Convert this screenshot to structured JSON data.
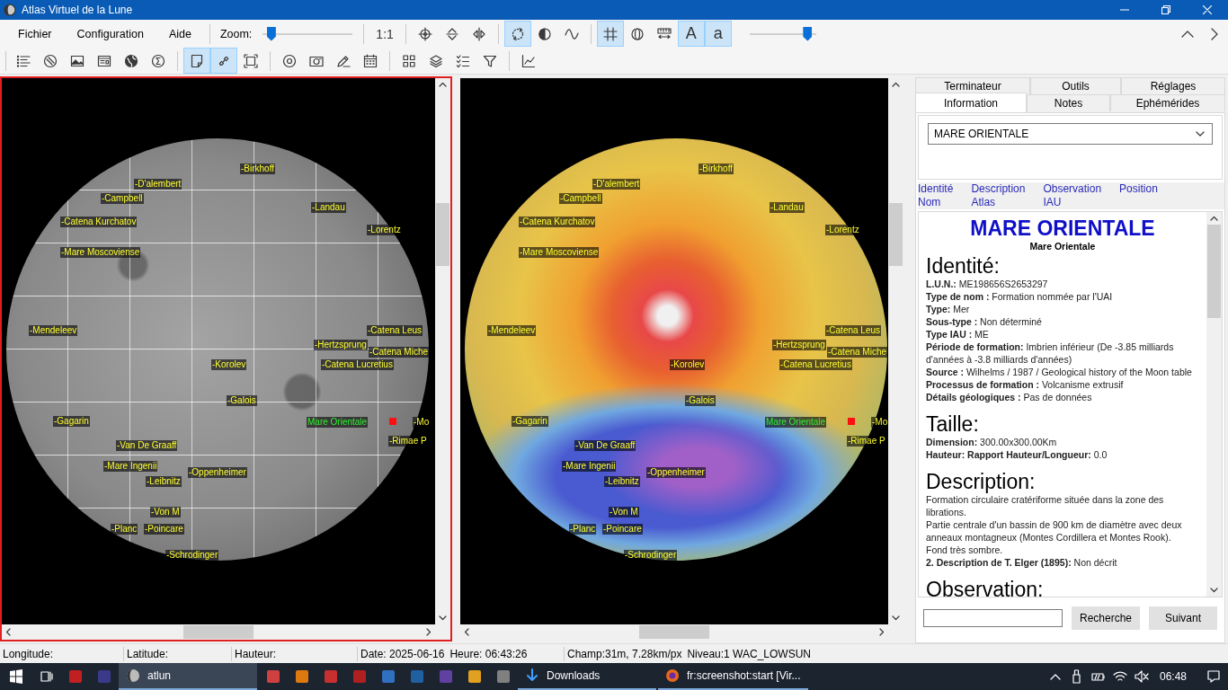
{
  "window": {
    "title": "Atlas Virtuel de la Lune"
  },
  "toolbar": {
    "menus": [
      "Fichier",
      "Configuration",
      "Aide"
    ],
    "zoom_label": "Zoom:",
    "zoom_slider": {
      "level": 0.05
    },
    "tool_groups": [
      [
        {
          "kind": "text",
          "label": "1:1",
          "on": false
        }
      ],
      [
        {
          "kind": "icon",
          "on": false
        },
        {
          "kind": "icon",
          "on": false
        },
        {
          "kind": "icon",
          "on": false
        }
      ],
      [
        {
          "kind": "icon",
          "on": true
        },
        {
          "kind": "icon",
          "on": false
        },
        {
          "kind": "icon",
          "on": false
        }
      ],
      [
        {
          "kind": "icon",
          "on": true
        },
        {
          "kind": "icon",
          "on": false
        },
        {
          "kind": "icon",
          "on": false
        },
        {
          "kind": "text",
          "label": "A",
          "on": true
        },
        {
          "kind": "text",
          "label": "a",
          "on": true
        }
      ]
    ],
    "level_slider": {
      "level": 0.93
    },
    "tool_groups_2": [
      [
        {
          "kind": "icon",
          "on": false
        },
        {
          "kind": "icon",
          "on": false
        },
        {
          "kind": "icon",
          "on": false
        },
        {
          "kind": "icon",
          "on": false
        },
        {
          "kind": "icon",
          "on": false
        },
        {
          "kind": "icon",
          "on": false
        }
      ],
      [
        {
          "kind": "icon",
          "on": true
        },
        {
          "kind": "icon",
          "on": true
        },
        {
          "kind": "icon",
          "on": false
        }
      ],
      [
        {
          "kind": "icon",
          "on": false
        },
        {
          "kind": "icon",
          "on": false
        },
        {
          "kind": "icon",
          "on": false
        },
        {
          "kind": "icon",
          "on": false
        }
      ],
      [
        {
          "kind": "icon",
          "on": false
        },
        {
          "kind": "icon",
          "on": false
        },
        {
          "kind": "icon",
          "on": false
        },
        {
          "kind": "icon",
          "on": false
        }
      ],
      [
        {
          "kind": "icon",
          "on": false
        }
      ]
    ]
  },
  "maps": [
    {
      "kind": "greyscale",
      "active": true,
      "labels": [
        {
          "text": "-Birkhoff",
          "selected": false
        },
        {
          "text": "-D'alembert",
          "selected": false
        },
        {
          "text": "-Campbell",
          "selected": false
        },
        {
          "text": "-Catena Kurchatov",
          "selected": false
        },
        {
          "text": "-Landau",
          "selected": false
        },
        {
          "text": "-Lorentz",
          "selected": false
        },
        {
          "text": "-Mare Moscoviense",
          "selected": false
        },
        {
          "text": "-Mendeleev",
          "selected": false
        },
        {
          "text": "-Catena Leus",
          "selected": false
        },
        {
          "text": "-Hertzsprung",
          "selected": false
        },
        {
          "text": "-Catena Miche",
          "selected": false
        },
        {
          "text": "-Korolev",
          "selected": false
        },
        {
          "text": "-Catena Lucretius",
          "selected": false
        },
        {
          "text": "-Galois",
          "selected": false
        },
        {
          "text": "Mare Orientale",
          "selected": true
        },
        {
          "text": "-Mo",
          "selected": false
        },
        {
          "text": "-Rimae P",
          "selected": false
        },
        {
          "text": "-Gagarin",
          "selected": false
        },
        {
          "text": "-Van De Graaff",
          "selected": false
        },
        {
          "text": "-Mare Ingenii",
          "selected": false
        },
        {
          "text": "-Oppenheimer",
          "selected": false
        },
        {
          "text": "-Leibnitz",
          "selected": false
        },
        {
          "text": "-Von M",
          "selected": false
        },
        {
          "text": "-Planc",
          "selected": false
        },
        {
          "text": "-Poincare",
          "selected": false
        },
        {
          "text": "-Schrodinger",
          "selected": false
        }
      ]
    },
    {
      "kind": "colored",
      "active": false,
      "labels": [
        {
          "text": "-Birkhoff",
          "selected": false
        },
        {
          "text": "-D'alembert",
          "selected": false
        },
        {
          "text": "-Campbell",
          "selected": false
        },
        {
          "text": "-Catena Kurchatov",
          "selected": false
        },
        {
          "text": "-Landau",
          "selected": false
        },
        {
          "text": "-Lorentz",
          "selected": false
        },
        {
          "text": "-Mare Moscoviense",
          "selected": false
        },
        {
          "text": "-Mendeleev",
          "selected": false
        },
        {
          "text": "-Catena Leus",
          "selected": false
        },
        {
          "text": "-Hertzsprung",
          "selected": false
        },
        {
          "text": "-Catena Miche",
          "selected": false
        },
        {
          "text": "-Korolev",
          "selected": false
        },
        {
          "text": "-Catena Lucretius",
          "selected": false
        },
        {
          "text": "-Galois",
          "selected": false
        },
        {
          "text": "Mare Orientale",
          "selected": true
        },
        {
          "text": "-Mo",
          "selected": false
        },
        {
          "text": "-Rimae P",
          "selected": false
        },
        {
          "text": "-Gagarin",
          "selected": false
        },
        {
          "text": "-Van De Graaff",
          "selected": false
        },
        {
          "text": "-Mare Ingenii",
          "selected": false
        },
        {
          "text": "-Oppenheimer",
          "selected": false
        },
        {
          "text": "-Leibnitz",
          "selected": false
        },
        {
          "text": "-Von M",
          "selected": false
        },
        {
          "text": "-Planc",
          "selected": false
        },
        {
          "text": "-Poincare",
          "selected": false
        },
        {
          "text": "-Schrodinger",
          "selected": false
        }
      ]
    }
  ],
  "info_panel": {
    "tab_rows": [
      [
        {
          "label": "Terminateur",
          "selected": false
        },
        {
          "label": "Outils",
          "selected": false
        },
        {
          "label": "Réglages",
          "selected": false
        }
      ],
      [
        {
          "label": "Information",
          "selected": true
        },
        {
          "label": "Notes",
          "selected": false
        },
        {
          "label": "Ephémérides",
          "selected": false
        }
      ]
    ],
    "selector": {
      "value": "MARE ORIENTALE"
    },
    "links": [
      "Identité Nom",
      "Description Atlas",
      "Observation IAU",
      "Position"
    ],
    "title": "MARE ORIENTALE",
    "subtitle": "Mare Orientale",
    "sections": [
      {
        "heading": "Identité:",
        "lines": [
          "**L.U.N.:** ME198656S2653297",
          "**Type de nom :** Formation nommée par l'UAI",
          "**Type:** Mer",
          "**Sous-type :** Non déterminé",
          "**Type IAU :** ME",
          "**Période de formation:** Imbrien inférieur (De -3.85 milliards d'années à -3.8 milliards d'années)",
          "**Source :** Wilhelms / 1987 / Geological history of the Moon table",
          "**Processus de formation :** Volcanisme extrusif",
          "**Détails géologiques :** Pas de données"
        ]
      },
      {
        "heading": "Taille:",
        "lines": [
          "**Dimension:** 300.00x300.00Km",
          "**Hauteur: Rapport Hauteur/Longueur:** 0.0"
        ]
      },
      {
        "heading": "Description:",
        "lines": [
          "Formation circulaire cratériforme située dans la zone des librations.",
          "Partie centrale d'un bassin de 900 km de diamètre avec deux anneaux montagneux (Montes Cordillera et Montes Rook).",
          "Fond très sombre.",
          "**2. Description de T. Elger (1895):** Non décrit"
        ]
      },
      {
        "heading": "Observation:"
      }
    ],
    "buttons": [
      "Recherche",
      "Suivant"
    ]
  },
  "status_bar": [
    [
      "Longitude:"
    ],
    [
      "Latitude:"
    ],
    [
      "Hauteur:"
    ],
    [
      "Date: 2025-06-16",
      "Heure: 06:43:26"
    ],
    [
      "Champ:31m, 7.28km/px",
      "Niveau:1 WAC_LOWSUN"
    ]
  ],
  "taskbar": {
    "windows": [
      {
        "label": "atlun",
        "selected": true
      },
      {
        "label": "Downloads",
        "selected": false
      },
      {
        "label": "fr:screenshot:start [Vir...",
        "selected": false
      }
    ],
    "clock": "06:48"
  }
}
